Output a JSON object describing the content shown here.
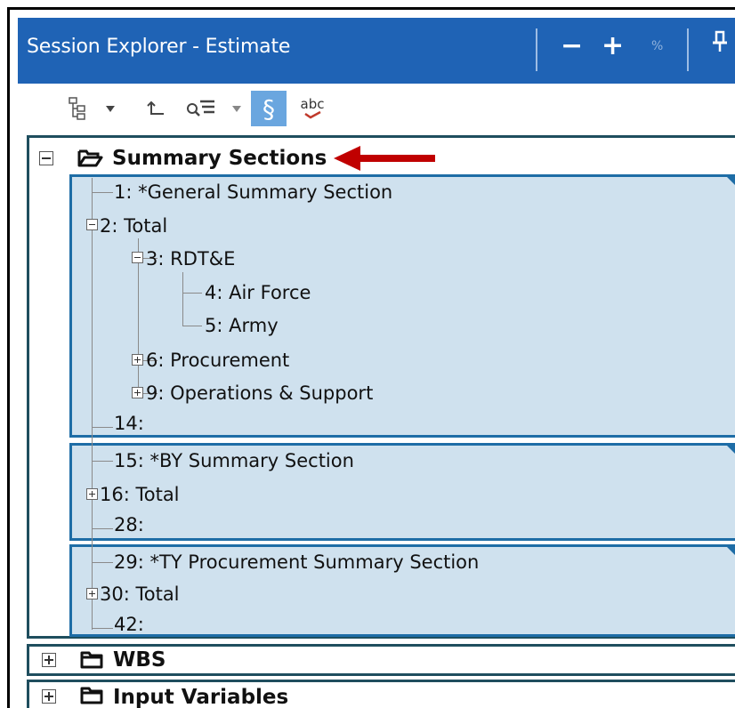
{
  "window": {
    "title": "Session Explorer - Estimate",
    "buttons": {
      "minus": "−",
      "plus": "+",
      "percent": "%",
      "pin": "⊥"
    }
  },
  "toolbar": {
    "tools": [
      {
        "icon": "tree-structure-icon"
      },
      {
        "icon": "dropdown-arrow-icon"
      },
      {
        "icon": "indent-left-icon"
      },
      {
        "icon": "sort-list-icon"
      },
      {
        "icon": "dropdown-arrow-icon"
      },
      {
        "icon": "section-icon",
        "label": "§",
        "active": true
      },
      {
        "icon": "spell-check-icon",
        "label": "abc"
      }
    ]
  },
  "sections": {
    "summary": {
      "label": "Summary Sections",
      "expanded": true,
      "groups": [
        {
          "rows": [
            {
              "text": "1: *General Summary Section"
            },
            {
              "text": "2: Total"
            },
            {
              "text": "3: RDT&E"
            },
            {
              "text": "4: Air Force"
            },
            {
              "text": "5: Army"
            },
            {
              "text": "6: Procurement"
            },
            {
              "text": "9: Operations & Support"
            },
            {
              "text": "14:"
            }
          ]
        },
        {
          "rows": [
            {
              "text": "15: *BY Summary Section"
            },
            {
              "text": "16: Total"
            },
            {
              "text": "28:"
            }
          ]
        },
        {
          "rows": [
            {
              "text": "29: *TY Procurement Summary Section"
            },
            {
              "text": "30: Total"
            },
            {
              "text": "42:"
            }
          ]
        }
      ]
    },
    "wbs": {
      "label": "WBS",
      "expanded": false
    },
    "input_variables": {
      "label": "Input Variables",
      "expanded": false
    }
  },
  "colors": {
    "titlebar": "#1f63b5",
    "group_fill": "#cfe1ee",
    "group_border": "#1e6da6",
    "arrow": "#c00000"
  }
}
